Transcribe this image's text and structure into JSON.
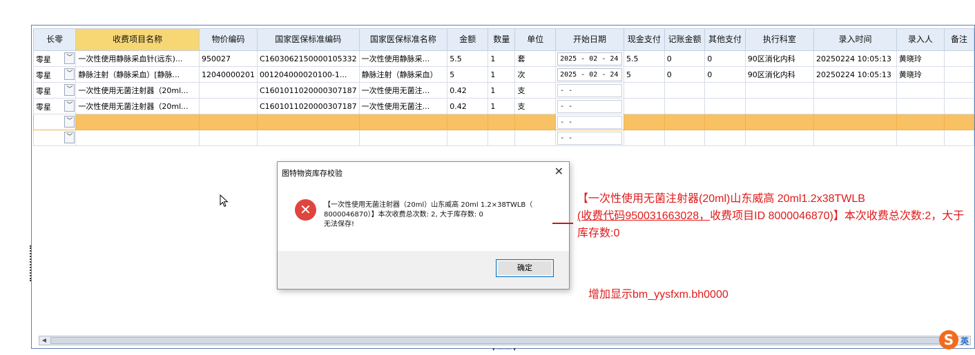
{
  "grid": {
    "columns": [
      "长零",
      "收费项目名称",
      "物价编码",
      "国家医保标准编码",
      "国家医保标准名称",
      "金额",
      "数量",
      "单位",
      "开始日期",
      "现金支付",
      "记账金额",
      "其他支付",
      "执行科室",
      "录入时间",
      "录入人",
      "备注"
    ],
    "rows": [
      {
        "type": "零星",
        "name": "一次性使用静脉采血针(远东)...",
        "price_code": "950027",
        "nat_code": "C1603062150000105332",
        "nat_name": "一次性使用静脉采...",
        "amount": "5.5",
        "qty": "1",
        "unit": "套",
        "start_date": "2025 - 02 - 24",
        "cash": "5.5",
        "account": "0",
        "other": "0",
        "dept": "90区消化内科",
        "entry_time": "20250224 10:05:13",
        "entered_by": "黄晓玲",
        "note": ""
      },
      {
        "type": "零星",
        "name": "静脉注射（静脉采血）[静脉...",
        "price_code": "12040000201",
        "nat_code": "001204000020100-1...",
        "nat_name": "静脉注射（静脉采血）",
        "amount": "5",
        "qty": "1",
        "unit": "次",
        "start_date": "2025 - 02 - 24",
        "cash": "5",
        "account": "0",
        "other": "0",
        "dept": "90区消化内科",
        "entry_time": "20250224 10:05:13",
        "entered_by": "黄晓玲",
        "note": ""
      },
      {
        "type": "零星",
        "name": "一次性使用无菌注射器（20ml...",
        "price_code": "",
        "nat_code": "C1601011020000307187",
        "nat_name": "一次性使用无菌注...",
        "amount": "0.42",
        "qty": "1",
        "unit": "支",
        "start_date": "  -  -",
        "cash": "",
        "account": "",
        "other": "",
        "dept": "",
        "entry_time": "",
        "entered_by": "",
        "note": ""
      },
      {
        "type": "零星",
        "name": "一次性使用无菌注射器（20ml...",
        "price_code": "",
        "nat_code": "C1601011020000307187",
        "nat_name": "一次性使用无菌注...",
        "amount": "0.42",
        "qty": "1",
        "unit": "支",
        "start_date": "  -  -",
        "cash": "",
        "account": "",
        "other": "",
        "dept": "",
        "entry_time": "",
        "entered_by": "",
        "note": ""
      },
      {
        "type": "",
        "name": "",
        "price_code": "",
        "nat_code": "",
        "nat_name": "",
        "amount": "",
        "qty": "",
        "unit": "",
        "start_date": "  -  -",
        "cash": "",
        "account": "",
        "other": "",
        "dept": "",
        "entry_time": "",
        "entered_by": "",
        "note": ""
      },
      {
        "type": "",
        "name": "",
        "price_code": "",
        "nat_code": "",
        "nat_name": "",
        "amount": "",
        "qty": "",
        "unit": "",
        "start_date": "  -  -",
        "cash": "",
        "account": "",
        "other": "",
        "dept": "",
        "entry_time": "",
        "entered_by": "",
        "note": ""
      }
    ],
    "selected_row": 4
  },
  "dialog": {
    "title": "图特物资库存校验",
    "close_glyph": "✕",
    "icon_glyph": "✕",
    "message_line1": "【一次性使用无菌注射器（20ml）山东威高 20ml 1.2×38TWLB（",
    "message_line2": "8000046870）】本次收费总次数: 2, 大于库存数: 0",
    "message_line3": "无法保存!",
    "ok_label": "确定"
  },
  "annotation": {
    "part1": "【一次性使用无菌注射器(20ml)山东威高 20ml1.2x38TWLB",
    "part2": "(收费代码950031663028，",
    "part3": "收费项目ID 8000046870)】本次收费总次数:2，大于库存数:0",
    "note": "增加显示bm_yysfxm.bh0000",
    "color": "#e01a1a"
  },
  "ime": {
    "logo": "S",
    "lang": "英"
  },
  "colors": {
    "header_highlight": "#f7d774",
    "selected_row": "#f8c163",
    "header_bg": "#e4ecf7",
    "error_red": "#e0443e"
  }
}
